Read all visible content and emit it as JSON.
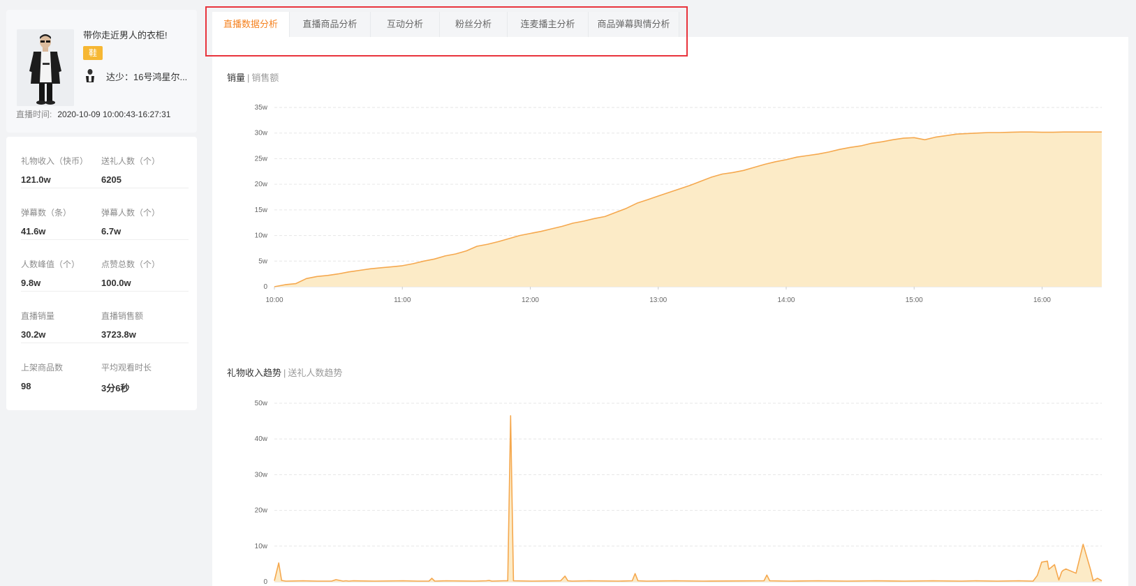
{
  "anchor": {
    "title": "带你走近男人的衣柜!",
    "tag": "鞋",
    "name": "达少：16号鸿星尔...",
    "live_time_label": "直播时间:",
    "live_time_value": "2020-10-09 10:00:43-16:27:31"
  },
  "stats": [
    [
      {
        "label": "礼物收入（快币）",
        "value": "121.0w"
      },
      {
        "label": "送礼人数（个）",
        "value": "6205"
      }
    ],
    [
      {
        "label": "弹幕数（条）",
        "value": "41.6w"
      },
      {
        "label": "弹幕人数（个）",
        "value": "6.7w"
      }
    ],
    [
      {
        "label": "人数峰值（个）",
        "value": "9.8w"
      },
      {
        "label": "点赞总数（个）",
        "value": "100.0w"
      }
    ],
    [
      {
        "label": "直播销量",
        "value": "30.2w"
      },
      {
        "label": "直播销售额",
        "value": "3723.8w"
      }
    ],
    [
      {
        "label": "上架商品数",
        "value": "98"
      },
      {
        "label": "平均观看时长",
        "value": "3分6秒"
      }
    ]
  ],
  "tabs": [
    {
      "label": "直播数据分析",
      "active": true
    },
    {
      "label": "直播商品分析",
      "active": false
    },
    {
      "label": "互动分析",
      "active": false
    },
    {
      "label": "粉丝分析",
      "active": false
    },
    {
      "label": "连麦播主分析",
      "active": false
    },
    {
      "label": "商品弹幕舆情分析",
      "active": false
    }
  ],
  "colors": {
    "accent": "#f58220",
    "line": "#f5a84e",
    "fill": "#fcebc7",
    "tag": "#f6b733",
    "highlight_border": "#e8333c"
  },
  "charts": {
    "sales": {
      "toggle_active": "销量",
      "toggle_other": "销售额"
    },
    "gifts": {
      "toggle_active": "礼物收入趋势",
      "toggle_other": "送礼人数趋势"
    }
  },
  "chart_data": [
    {
      "type": "area",
      "x_labels": [
        "10:00",
        "11:00",
        "12:00",
        "13:00",
        "14:00",
        "15:00",
        "16:00"
      ],
      "y_ticks": [
        "0",
        "5w",
        "10w",
        "15w",
        "20w",
        "25w",
        "30w",
        "35w"
      ],
      "ylim": [
        0,
        35
      ],
      "grid": true,
      "x": [
        0,
        5,
        10,
        15,
        20,
        25,
        30,
        35,
        40,
        45,
        50,
        55,
        60,
        65,
        70,
        75,
        80,
        85,
        90,
        95,
        100,
        105,
        110,
        115,
        120,
        125,
        130,
        135,
        140,
        145,
        150,
        155,
        160,
        165,
        170,
        175,
        180,
        185,
        190,
        195,
        200,
        205,
        210,
        215,
        220,
        225,
        230,
        235,
        240,
        245,
        250,
        255,
        260,
        265,
        270,
        275,
        280,
        285,
        290,
        295,
        300,
        305,
        310,
        315,
        320,
        325,
        330,
        335,
        340,
        345,
        350,
        355,
        360,
        365,
        370,
        375,
        380,
        385,
        388
      ],
      "y": [
        0,
        0.4,
        0.6,
        1.6,
        2.0,
        2.2,
        2.5,
        2.9,
        3.2,
        3.5,
        3.7,
        3.9,
        4.1,
        4.5,
        5.0,
        5.4,
        6.0,
        6.4,
        7.0,
        7.9,
        8.3,
        8.8,
        9.4,
        10.0,
        10.4,
        10.8,
        11.3,
        11.8,
        12.4,
        12.8,
        13.3,
        13.7,
        14.5,
        15.3,
        16.3,
        17.0,
        17.7,
        18.4,
        19.1,
        19.8,
        20.6,
        21.4,
        22.0,
        22.3,
        22.7,
        23.3,
        23.9,
        24.4,
        24.8,
        25.3,
        25.6,
        25.9,
        26.3,
        26.8,
        27.2,
        27.5,
        28.0,
        28.3,
        28.7,
        29.0,
        29.1,
        28.7,
        29.2,
        29.5,
        29.8,
        29.9,
        30.0,
        30.1,
        30.1,
        30.15,
        30.2,
        30.2,
        30.15,
        30.15,
        30.2,
        30.2,
        30.2,
        30.2,
        30.2
      ]
    },
    {
      "type": "area",
      "x_labels": [],
      "y_ticks": [
        "0",
        "10w",
        "20w",
        "30w",
        "40w",
        "50w"
      ],
      "ylim": [
        0,
        50
      ],
      "grid": true,
      "x": [
        0,
        3,
        5,
        8,
        20,
        30,
        40,
        43,
        48,
        50,
        52,
        55,
        70,
        90,
        100,
        108,
        110,
        112,
        120,
        140,
        148,
        150,
        152,
        160,
        180,
        200,
        203,
        205,
        208,
        220,
        240,
        250,
        252,
        254,
        260,
        280,
        300,
        342,
        344,
        346,
        360,
        380,
        400,
        420,
        440,
        460,
        480,
        490,
        505,
        520,
        530,
        533,
        536,
        540,
        541,
        545,
        548,
        550,
        551,
        553,
        560,
        565,
        570,
        572,
        575,
        578
      ],
      "y": [
        0.3,
        5.3,
        0.4,
        0.2,
        0.3,
        0.2,
        0.2,
        0.6,
        0.2,
        0.3,
        0.2,
        0.3,
        0.2,
        0.3,
        0.2,
        0.2,
        1.0,
        0.2,
        0.3,
        0.2,
        0.3,
        0.4,
        0.2,
        0.3,
        0.2,
        0.3,
        1.6,
        0.3,
        0.2,
        0.3,
        0.2,
        0.3,
        2.3,
        0.3,
        0.2,
        0.3,
        0.2,
        0.3,
        1.9,
        0.3,
        0.2,
        0.3,
        0.2,
        0.3,
        0.2,
        0.3,
        0.2,
        0.3,
        0.2,
        0.3,
        0.2,
        1.8,
        5.5,
        5.8,
        3.5,
        4.8,
        0.5,
        2.8,
        3.2,
        3.6,
        2.4,
        10.5,
        3.6,
        0.3,
        1.0,
        0.3
      ],
      "peak": {
        "x": 165,
        "y": 46.5
      }
    }
  ]
}
